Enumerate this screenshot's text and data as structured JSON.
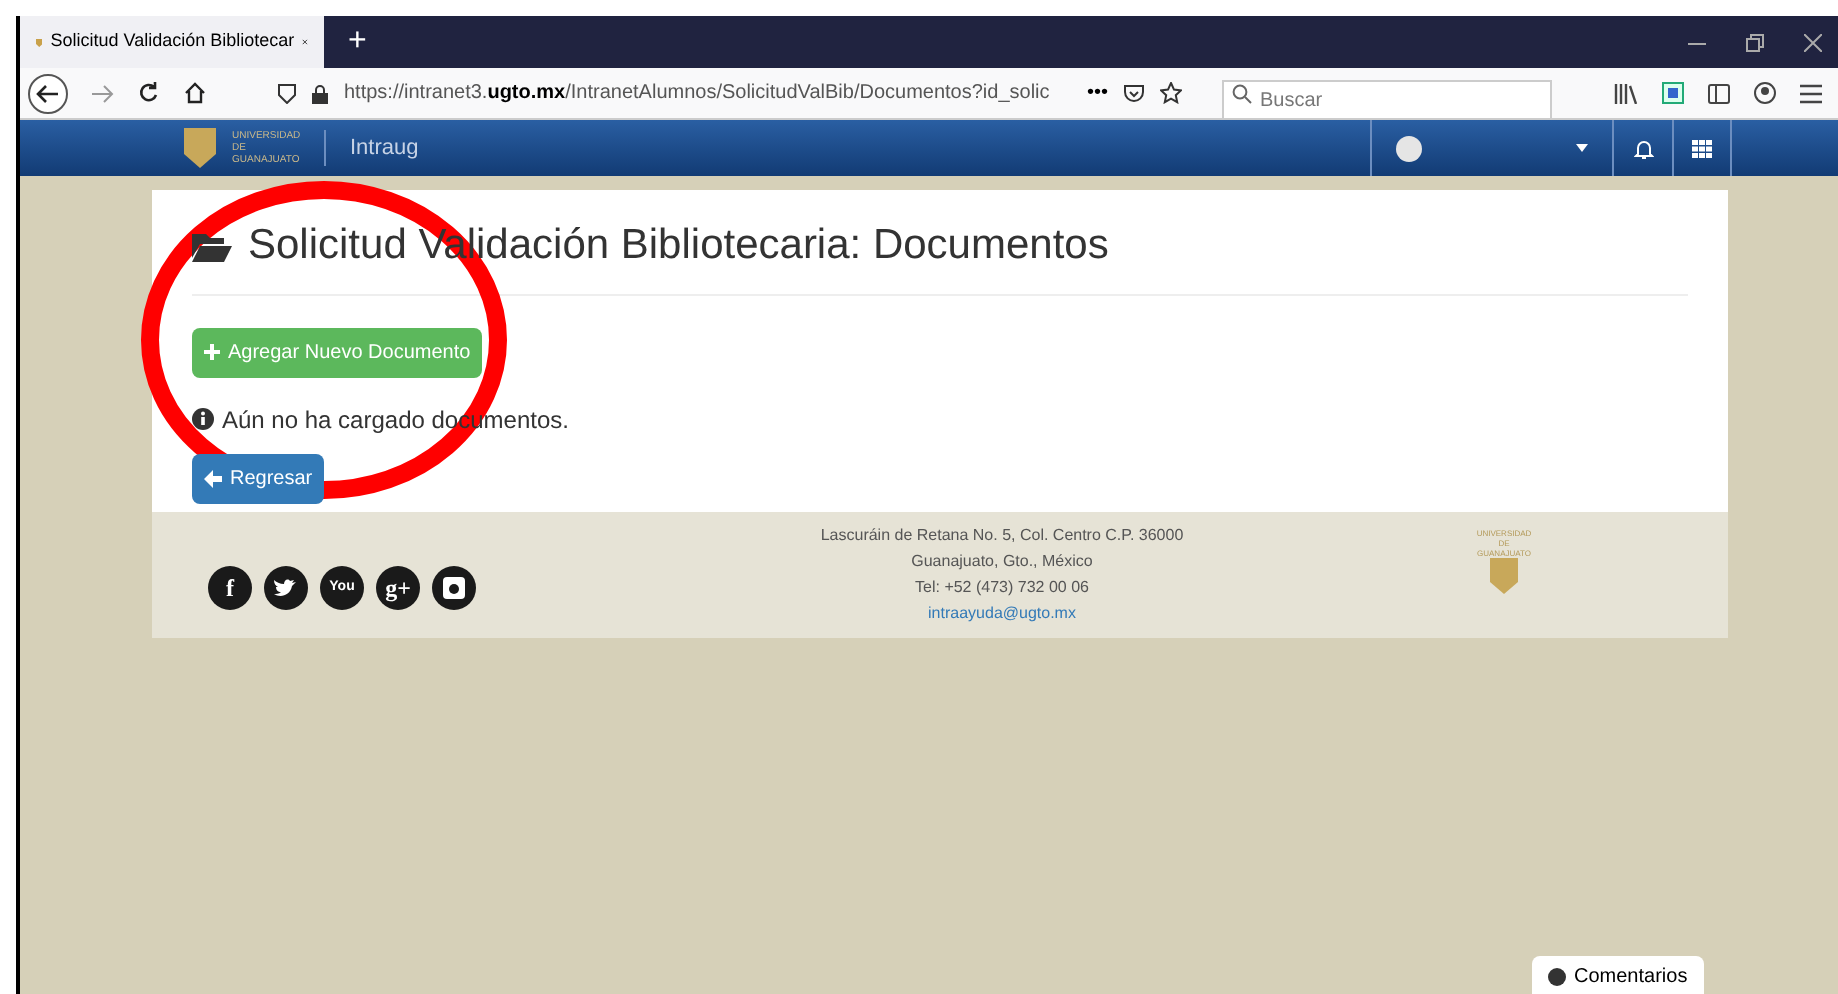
{
  "browser": {
    "tab_title": "Solicitud Validación Bibliotecar",
    "new_tab": "+",
    "url_prefix": "https://intranet3.",
    "url_domain": "ugto.mx",
    "url_rest": "/IntranetAlumnos/SolicitudValBib/Documentos?id_solic",
    "more": "•••",
    "search": {
      "placeholder": "Buscar"
    }
  },
  "header": {
    "logo_text": "UNIVERSIDAD DE GUANAJUATO",
    "app_name": "Intraug"
  },
  "page": {
    "title": "Solicitud Validación Bibliotecaria: Documentos",
    "add_button": "Agregar Nuevo Documento",
    "notice": "Aún no ha cargado documentos.",
    "back_button": "Regresar"
  },
  "footer": {
    "address_lines": [
      "Lascuráin de Retana No. 5, Col. Centro C.P. 36000",
      "Guanajuato, Gto., México",
      "Tel: +52 (473) 732 00 06"
    ],
    "email": "intraayuda@ugto.mx",
    "social": [
      {
        "kind": "facebook",
        "label": "f"
      },
      {
        "kind": "twitter"
      },
      {
        "kind": "youtube",
        "label": "You"
      },
      {
        "kind": "googleplus",
        "label": "g+"
      },
      {
        "kind": "instagram"
      }
    ],
    "logo_text": "UNIVERSIDAD DE GUANAJUATO"
  },
  "feedback_button": "Comentarios"
}
